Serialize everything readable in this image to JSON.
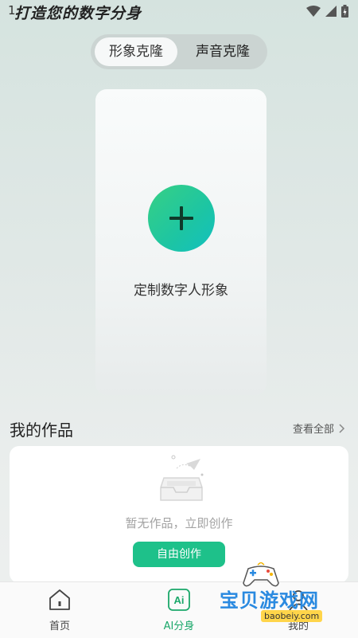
{
  "status_bar": {
    "time": "1"
  },
  "heading": "打造您的数字分身",
  "segment": {
    "options": [
      "形象克隆",
      "声音克隆"
    ],
    "selected": "形象克隆"
  },
  "create_card": {
    "label": "定制数字人形象"
  },
  "works": {
    "title": "我的作品",
    "view_all": "查看全部",
    "empty_text": "暂无作品，立即创作",
    "free_create_button": "自由创作"
  },
  "bottom_nav": [
    {
      "label": "首页",
      "icon": "home-icon",
      "active": false
    },
    {
      "label": "AI分身",
      "icon": "ai-icon",
      "active": true
    },
    {
      "label": "我的",
      "icon": "profile-icon",
      "active": false
    }
  ],
  "watermark": {
    "text": "宝贝游戏网",
    "url": "baobeiy.com"
  },
  "colors": {
    "accent": "#1ec18a",
    "active_nav": "#1aa86a"
  }
}
